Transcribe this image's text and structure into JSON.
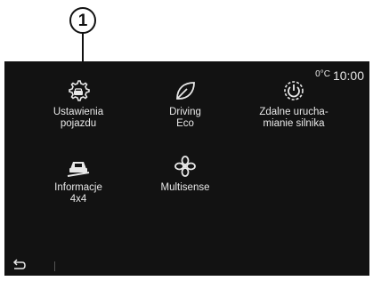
{
  "callout": {
    "number": "1"
  },
  "status": {
    "temperature": "0°C",
    "time": "10:00"
  },
  "apps": [
    {
      "label": "Ustawienia\npojazdu",
      "icon": "vehicle-settings-icon"
    },
    {
      "label": "Driving\nEco",
      "icon": "eco-leaf-icon"
    },
    {
      "label": "Zdalne urucha-\nmianie silnika",
      "icon": "remote-start-icon"
    },
    {
      "label": "Informacje\n4x4",
      "icon": "4x4-vehicle-icon"
    },
    {
      "label": "Multisense",
      "icon": "multisense-icon"
    }
  ],
  "navigation": {
    "back": "back-arrow-icon"
  }
}
